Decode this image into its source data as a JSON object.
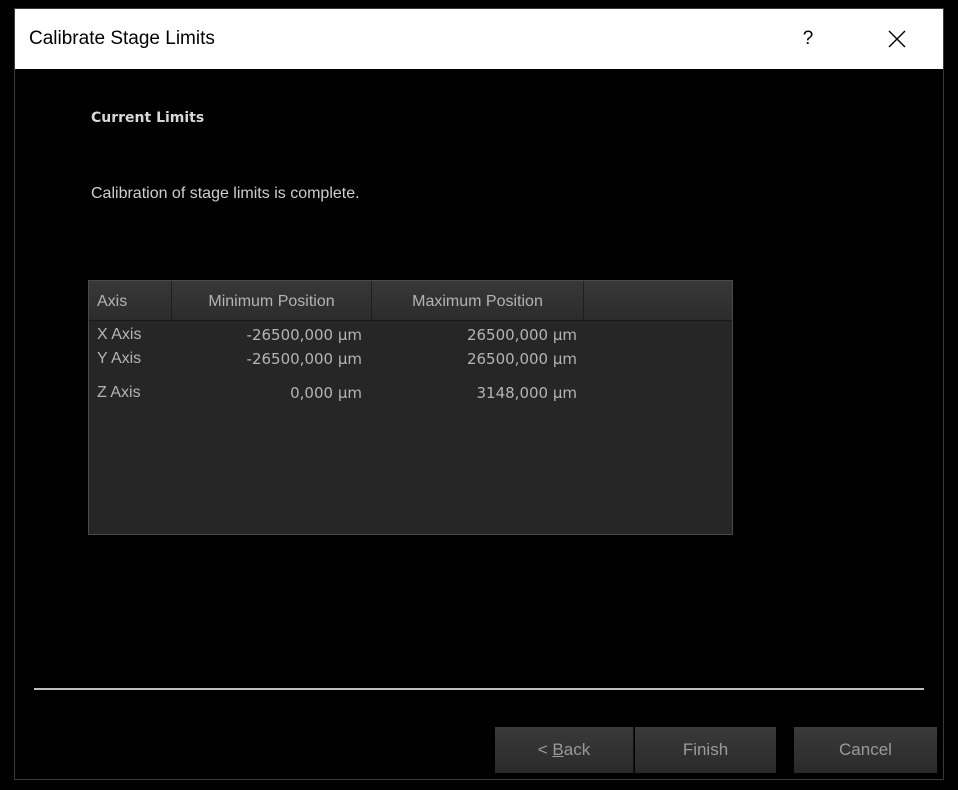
{
  "window": {
    "title": "Calibrate Stage Limits",
    "help_label": "?",
    "close_icon": "close-x-icon"
  },
  "page": {
    "heading": "Current Limits",
    "message": "Calibration of stage limits is complete."
  },
  "table": {
    "columns": [
      "Axis",
      "Minimum Position",
      "Maximum Position"
    ],
    "rows": [
      {
        "axis": "X Axis",
        "min": "-26500,000 µm",
        "max": "26500,000 µm"
      },
      {
        "axis": "Y Axis",
        "min": "-26500,000 µm",
        "max": "26500,000 µm"
      },
      {
        "axis": "Z Axis",
        "min": "0,000 µm",
        "max": "3148,000 µm"
      }
    ]
  },
  "buttons": {
    "back_prefix": "< ",
    "back_mnemonic": "B",
    "back_rest": "ack",
    "finish": "Finish",
    "cancel": "Cancel"
  },
  "colors": {
    "background": "#000000",
    "titlebar": "#ffffff",
    "table_bg": "#262626",
    "text": "#b4b4b4"
  }
}
